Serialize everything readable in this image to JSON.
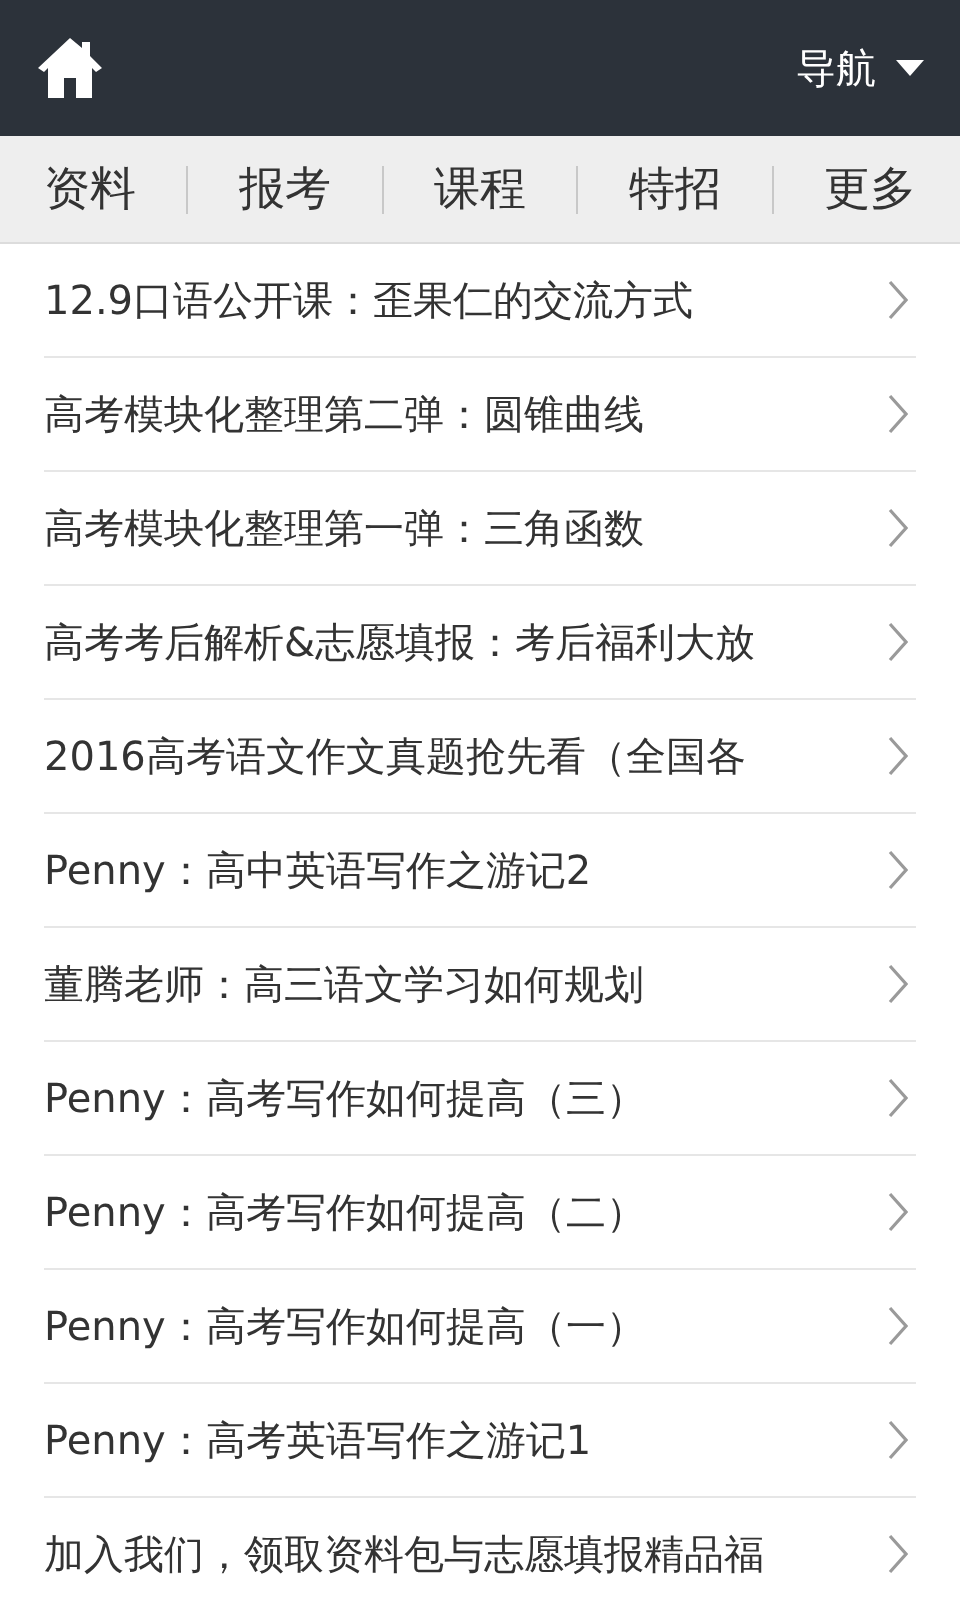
{
  "header": {
    "nav_label": "导航"
  },
  "tabs": [
    {
      "label": "资料"
    },
    {
      "label": "报考"
    },
    {
      "label": "课程"
    },
    {
      "label": "特招"
    },
    {
      "label": "更多"
    }
  ],
  "articles": [
    {
      "title": "12.9口语公开课：歪果仁的交流方式"
    },
    {
      "title": "高考模块化整理第二弹：圆锥曲线"
    },
    {
      "title": "高考模块化整理第一弹：三角函数"
    },
    {
      "title": "高考考后解析&志愿填报：考后福利大放"
    },
    {
      "title": "2016高考语文作文真题抢先看（全国各"
    },
    {
      "title": "Penny：高中英语写作之游记2"
    },
    {
      "title": "董腾老师：高三语文学习如何规划"
    },
    {
      "title": "Penny：高考写作如何提高（三）"
    },
    {
      "title": "Penny：高考写作如何提高（二）"
    },
    {
      "title": "Penny：高考写作如何提高（一）"
    },
    {
      "title": "Penny：高考英语写作之游记1"
    },
    {
      "title": "加入我们，领取资料包与志愿填报精品福"
    }
  ]
}
